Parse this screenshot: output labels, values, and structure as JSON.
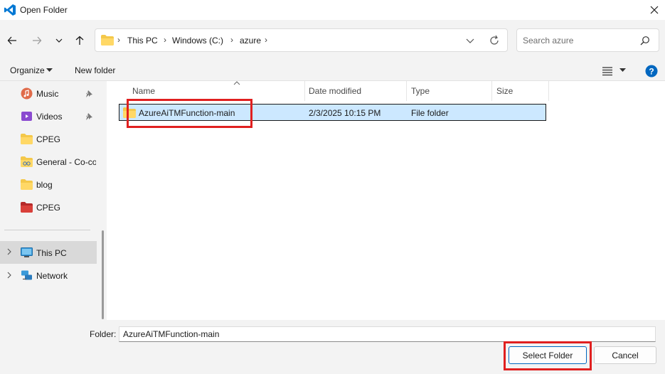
{
  "window": {
    "title": "Open Folder"
  },
  "address": {
    "crumbs": [
      "This PC",
      "Windows (C:)",
      "azure"
    ]
  },
  "search": {
    "placeholder": "Search azure"
  },
  "toolbar": {
    "organize_label": "Organize",
    "new_folder_label": "New folder"
  },
  "sidebar": {
    "items": [
      {
        "label": "Music",
        "icon": "music-icon",
        "pinned": true
      },
      {
        "label": "Videos",
        "icon": "videos-icon",
        "pinned": true
      },
      {
        "label": "CPEG",
        "icon": "folder-icon",
        "pinned": false
      },
      {
        "label": "General - Co-co",
        "icon": "shared-folder-icon",
        "pinned": false
      },
      {
        "label": "blog",
        "icon": "folder-icon",
        "pinned": false
      },
      {
        "label": "CPEG",
        "icon": "red-folder-icon",
        "pinned": false
      }
    ],
    "locations": [
      {
        "label": "This PC",
        "icon": "computer-icon",
        "selected": true
      },
      {
        "label": "Network",
        "icon": "network-icon",
        "selected": false
      }
    ]
  },
  "table": {
    "columns": [
      "Name",
      "Date modified",
      "Type",
      "Size"
    ],
    "rows": [
      {
        "name": "AzureAiTMFunction-main",
        "date": "2/3/2025 10:15 PM",
        "type": "File folder",
        "size": ""
      }
    ]
  },
  "footer": {
    "folder_label": "Folder:",
    "folder_value": "AzureAiTMFunction-main",
    "select_label": "Select Folder",
    "cancel_label": "Cancel"
  },
  "colors": {
    "accent": "#0067c0",
    "selection": "#cce8ff",
    "highlight": "#e02020",
    "folder": "#f4c84a"
  }
}
